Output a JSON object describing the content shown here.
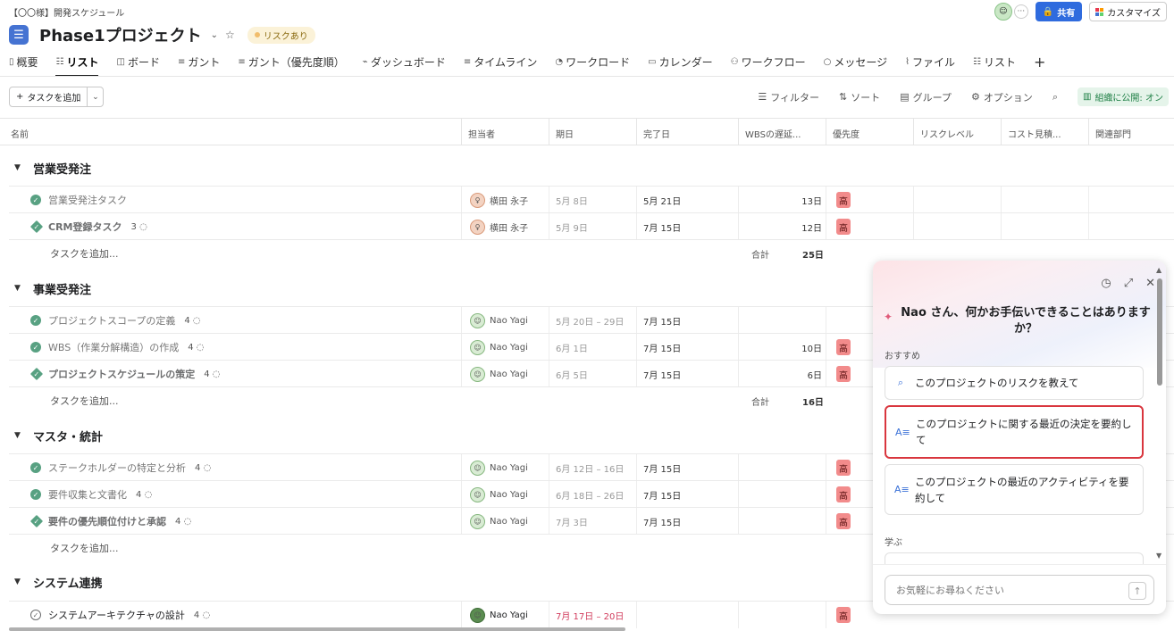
{
  "breadcrumb": "【〇〇様】開発スケジュール",
  "header": {
    "project_title": "Phase1プロジェクト",
    "risk_badge": "リスクあり",
    "share_label": "共有",
    "customize_label": "カスタマイズ",
    "more_label": "···"
  },
  "tabs": [
    {
      "label": "概要",
      "icon": "overview-icon"
    },
    {
      "label": "リスト",
      "icon": "list-icon",
      "active": true
    },
    {
      "label": "ボード",
      "icon": "board-icon"
    },
    {
      "label": "ガント",
      "icon": "gantt-icon"
    },
    {
      "label": "ガント（優先度順）",
      "icon": "gantt-icon"
    },
    {
      "label": "ダッシュボード",
      "icon": "dashboard-icon"
    },
    {
      "label": "タイムライン",
      "icon": "timeline-icon"
    },
    {
      "label": "ワークロード",
      "icon": "workload-icon"
    },
    {
      "label": "カレンダー",
      "icon": "calendar-icon"
    },
    {
      "label": "ワークフロー",
      "icon": "workflow-icon"
    },
    {
      "label": "メッセージ",
      "icon": "message-icon"
    },
    {
      "label": "ファイル",
      "icon": "file-icon"
    },
    {
      "label": "リスト",
      "icon": "list-icon"
    }
  ],
  "toolbar": {
    "add_task": "タスクを追加",
    "filter": "フィルター",
    "sort": "ソート",
    "group": "グループ",
    "options": "オプション",
    "publish": "組織に公開: オン"
  },
  "columns": {
    "name": "名前",
    "assignee": "担当者",
    "due": "期日",
    "done": "完了日",
    "wbs": "WBSの遅延...",
    "priority": "優先度",
    "risk": "リスクレベル",
    "cost": "コスト見積...",
    "dept": "関連部門"
  },
  "add_task_row": "タスクを追加...",
  "sum_label": "合計",
  "sections": [
    {
      "title": "営業受発注",
      "total": "25日",
      "tasks": [
        {
          "name": "営業受発注タスク",
          "comments": "",
          "assignee": "横田 永子",
          "due": "5月 8日",
          "done": "5月 21日",
          "wbs": "13日",
          "priority": "高"
        },
        {
          "name": "CRM登録タスク",
          "comments": "3",
          "assignee": "横田 永子",
          "due": "5月 9日",
          "done": "7月 15日",
          "wbs": "12日",
          "priority": "高"
        }
      ]
    },
    {
      "title": "事業受発注",
      "total": "16日",
      "tasks": [
        {
          "name": "プロジェクトスコープの定義",
          "comments": "4",
          "assignee": "Nao Yagi",
          "due": "5月 20日 – 29日",
          "done": "7月 15日",
          "wbs": "",
          "priority": ""
        },
        {
          "name": "WBS（作業分解構造）の作成",
          "comments": "4",
          "assignee": "Nao Yagi",
          "due": "6月 1日",
          "done": "7月 15日",
          "wbs": "10日",
          "priority": "高"
        },
        {
          "name": "プロジェクトスケジュールの策定",
          "comments": "4",
          "assignee": "Nao Yagi",
          "due": "6月 5日",
          "done": "7月 15日",
          "wbs": "6日",
          "priority": "高"
        }
      ]
    },
    {
      "title": "マスタ・統計",
      "tasks": [
        {
          "name": "ステークホルダーの特定と分析",
          "comments": "4",
          "assignee": "Nao Yagi",
          "due": "6月 12日 – 16日",
          "done": "7月 15日",
          "wbs": "",
          "priority": "高"
        },
        {
          "name": "要件収集と文書化",
          "comments": "4",
          "assignee": "Nao Yagi",
          "due": "6月 18日 – 26日",
          "done": "7月 15日",
          "wbs": "",
          "priority": "高"
        },
        {
          "name": "要件の優先順位付けと承認",
          "comments": "4",
          "assignee": "Nao Yagi",
          "due": "7月 3日",
          "done": "7月 15日",
          "wbs": "",
          "priority": "高"
        }
      ]
    },
    {
      "title": "システム連携",
      "tasks": [
        {
          "name": "システムアーキテクチャの設計",
          "comments": "4",
          "assignee": "Nao Yagi",
          "due": "7月 17日 – 20日",
          "done": "",
          "wbs": "",
          "priority": "高"
        }
      ]
    }
  ],
  "ai_panel": {
    "greeting": "Nao さん、何かお手伝いできることはありますか？",
    "recommended_label": "おすすめ",
    "suggestions": [
      {
        "text": "このプロジェクトのリスクを教えて",
        "icon": "search-icon"
      },
      {
        "text": "このプロジェクトに関する最近の決定を要約して",
        "icon": "summary-icon"
      },
      {
        "text": "このプロジェクトの最近のアクティビティを要約して",
        "icon": "summary-icon"
      }
    ],
    "learn_label": "学ぶ",
    "input_placeholder": "お気軽にお尋ねください"
  },
  "colors": {
    "accent": "#2f6bde",
    "check_green": "#58a182",
    "priority_high": "#f28b8b",
    "highlight_border": "#d9363e"
  }
}
